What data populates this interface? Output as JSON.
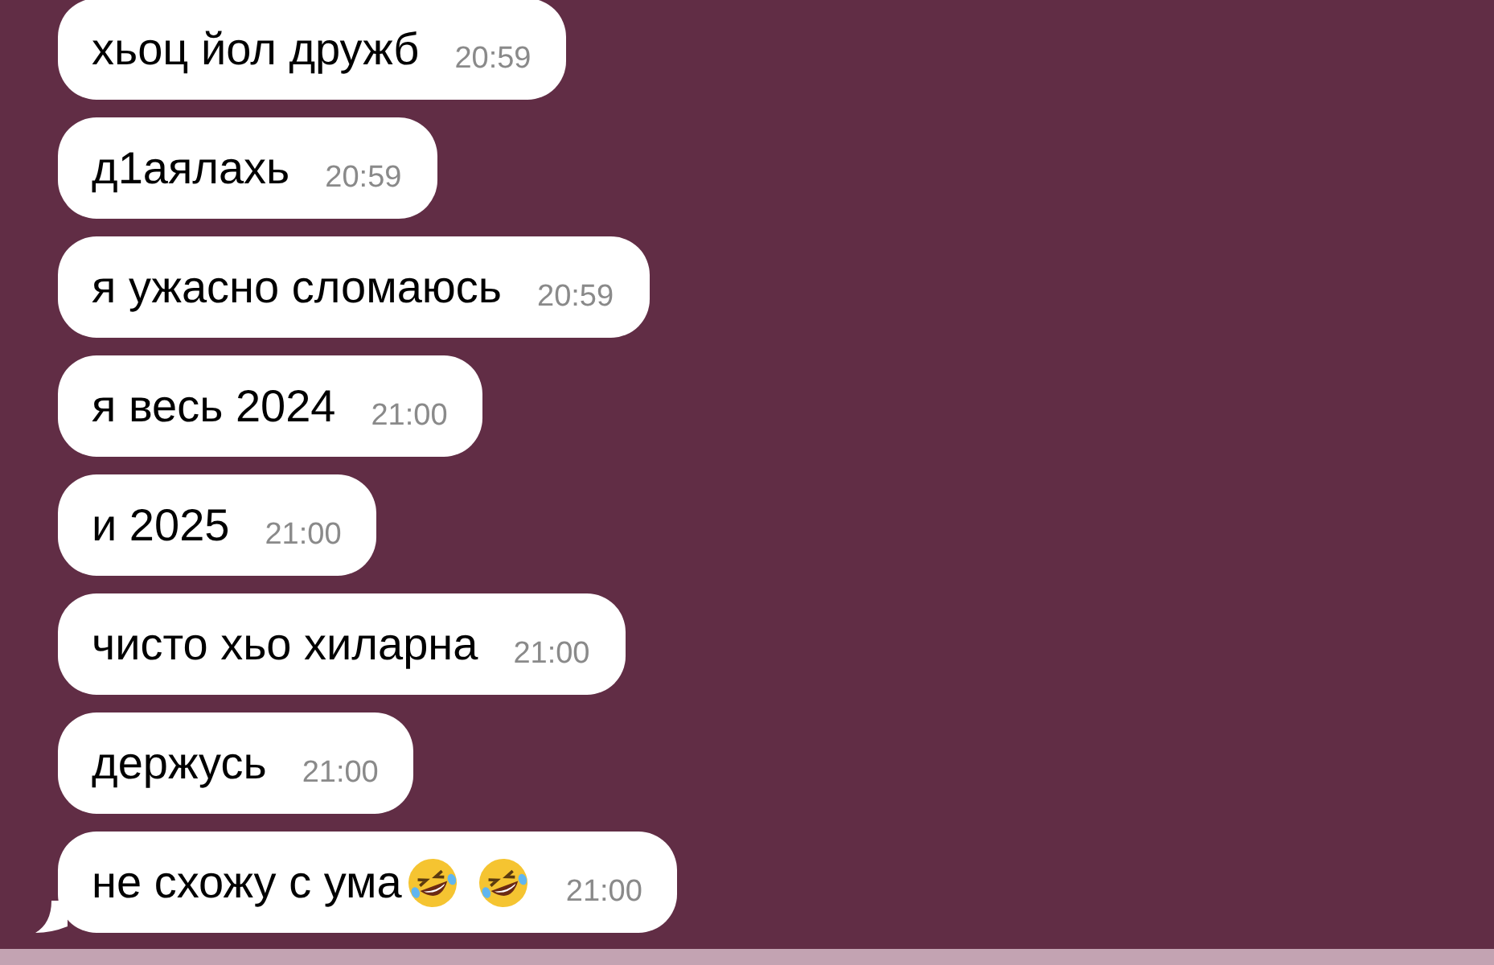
{
  "messages": [
    {
      "text": "хьоц йол дружб",
      "time": "20:59",
      "tail": false
    },
    {
      "text": "д1аялахь",
      "time": "20:59",
      "tail": false
    },
    {
      "text": "я ужасно сломаюсь",
      "time": "20:59",
      "tail": false
    },
    {
      "text": "я весь 2024",
      "time": "21:00",
      "tail": false
    },
    {
      "text": "и 2025",
      "time": "21:00",
      "tail": false
    },
    {
      "text": "чисто хьо хиларна",
      "time": "21:00",
      "tail": false
    },
    {
      "text": "держусь",
      "time": "21:00",
      "tail": false
    },
    {
      "text": "не схожу с ума",
      "emojis": [
        {
          "kind": "rolling-laughing"
        },
        {
          "kind": "rolling-laughing"
        }
      ],
      "time": "21:00",
      "tail": true
    }
  ]
}
